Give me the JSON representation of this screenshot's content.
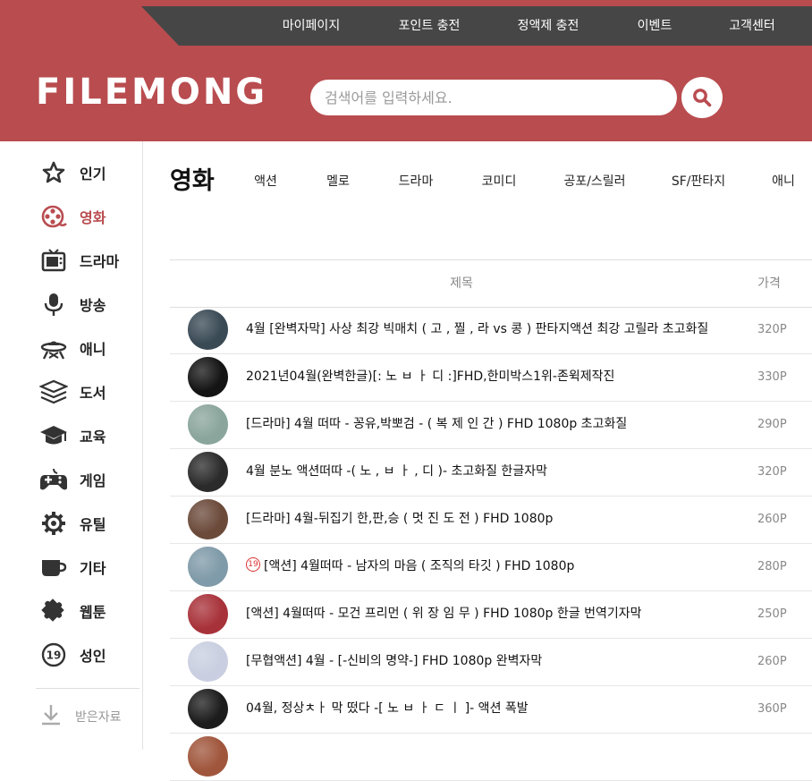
{
  "header": {
    "logo": "FILEMONG",
    "top_nav": [
      "마이페이지",
      "포인트 충전",
      "정액제 충전",
      "이벤트",
      "고객센터"
    ],
    "search_placeholder": "검색어를 입력하세요."
  },
  "sidebar": {
    "items": [
      {
        "label": "인기",
        "icon": "star-icon",
        "active": false
      },
      {
        "label": "영화",
        "icon": "film-reel-icon",
        "active": true
      },
      {
        "label": "드라마",
        "icon": "tv-icon",
        "active": false
      },
      {
        "label": "방송",
        "icon": "microphone-icon",
        "active": false
      },
      {
        "label": "애니",
        "icon": "ufo-icon",
        "active": false
      },
      {
        "label": "도서",
        "icon": "books-icon",
        "active": false
      },
      {
        "label": "교육",
        "icon": "graduation-cap-icon",
        "active": false
      },
      {
        "label": "게임",
        "icon": "gamepad-icon",
        "active": false
      },
      {
        "label": "유틸",
        "icon": "gear-icon",
        "active": false
      },
      {
        "label": "기타",
        "icon": "cup-icon",
        "active": false
      },
      {
        "label": "웹툰",
        "icon": "puzzle-icon",
        "active": false
      },
      {
        "label": "성인",
        "icon": "age-19-icon",
        "active": false
      }
    ],
    "downloads": {
      "label": "받은자료",
      "icon": "download-icon"
    }
  },
  "category": {
    "title": "영화",
    "tabs": [
      "액션",
      "멜로",
      "드라마",
      "코미디",
      "공포/스릴러",
      "SF/판타지",
      "애니"
    ]
  },
  "table": {
    "columns": [
      "제목",
      "가격"
    ],
    "rows": [
      {
        "title": "4월 [완벽자막] 사상 최강 빅매치 ( 고 , 찔 , 라 vs 콩 ) 판타지액션 최강 고릴라 초고화질",
        "price": "320P",
        "adult": false,
        "thumb": "#3a4a55"
      },
      {
        "title": "2021년04월(완벽한글)[: 노 ㅂ ㅏ 디 :]FHD,한미박스1위-존윅제작진",
        "price": "330P",
        "adult": false,
        "thumb": "#141414"
      },
      {
        "title": "[드라마] 4월 떠따 - 꽁유,박뽀검 - ( 복 제 인 간 ) FHD 1080p 초고화질",
        "price": "290P",
        "adult": false,
        "thumb": "#8aa59c"
      },
      {
        "title": "4월 분노 액션떠따 -( 노 , ㅂ ㅏ , 디 )- 초고화질 한글자막",
        "price": "320P",
        "adult": false,
        "thumb": "#2b2b2b"
      },
      {
        "title": "[드라마] 4월-뒤집기 한,판,승 ( 멋 진 도 전 ) FHD 1080p",
        "price": "260P",
        "adult": false,
        "thumb": "#6b4a3a"
      },
      {
        "title": "[액션] 4월떠따 - 남자의 마음 ( 조직의 타깃 ) FHD 1080p",
        "price": "280P",
        "adult": true,
        "adult_mark": "19",
        "thumb": "#7f9aa8"
      },
      {
        "title": "[액션] 4월떠따 - 모건 프리먼 ( 위 장 임 무 ) FHD 1080p 한글 번역기자막",
        "price": "250P",
        "adult": false,
        "thumb": "#a8323a"
      },
      {
        "title": "[무협액션] 4월 - [-신비의 명약-] FHD 1080p 완벽자막",
        "price": "260P",
        "adult": false,
        "thumb": "#c9cfe0"
      },
      {
        "title": "04월, 정상ㅊㅏ 막 떴다 -[ 노 ㅂ ㅏ ㄷ ㅣ ]- 액션 폭발",
        "price": "360P",
        "adult": false,
        "thumb": "#1c1c1c"
      },
      {
        "title": "",
        "price": "",
        "adult": false,
        "thumb": "#a0563c"
      }
    ]
  },
  "colors": {
    "brand": "#b94c4f",
    "topbar": "#464646",
    "text": "#222222",
    "muted": "#888888"
  }
}
